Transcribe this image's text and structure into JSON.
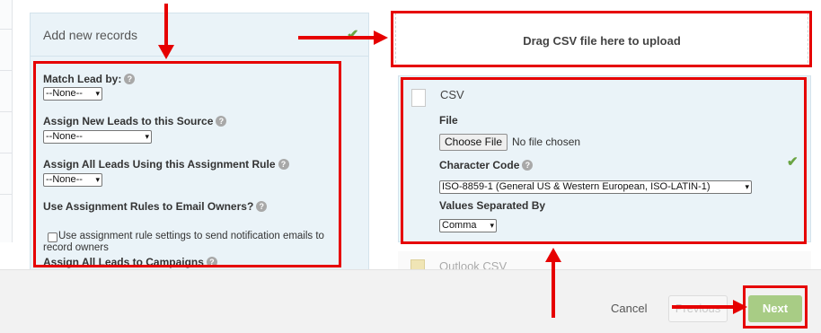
{
  "records_panel": {
    "title": "Add new records",
    "checkmark": "✔",
    "fields": {
      "match_lead": {
        "label": "Match Lead by:",
        "value": "--None--"
      },
      "assign_source": {
        "label": "Assign New Leads to this Source",
        "value": "--None--"
      },
      "assignment_rule": {
        "label": "Assign All Leads Using this Assignment Rule",
        "value": "--None--"
      },
      "email_owners": {
        "label": "Use Assignment Rules to Email Owners?",
        "checkbox_text": "Use assignment rule settings to send notification emails to record owners",
        "checked": false
      },
      "campaigns": {
        "label": "Assign All Leads to Campaigns"
      }
    }
  },
  "upload": {
    "drop_text": "Drag CSV file here to upload"
  },
  "csv_panel": {
    "title": "CSV",
    "checkmark": "✔",
    "file_label": "File",
    "choose_file_label": "Choose File",
    "file_status": "No file chosen",
    "char_code_label": "Character Code",
    "char_code_value": "ISO-8859-1 (General US & Western European, ISO-LATIN-1)",
    "separator_label": "Values Separated By",
    "separator_value": "Comma"
  },
  "outlook": {
    "label": "Outlook CSV"
  },
  "footer": {
    "cancel_label": "Cancel",
    "previous_label": "Previous",
    "next_label": "Next"
  },
  "help_glyph": "?",
  "caret_glyph": "▾",
  "colors": {
    "panel_bg": "#eaf3f8",
    "highlight_red": "#e60000",
    "next_green": "#a8cc85",
    "check_green": "#6aa443"
  }
}
